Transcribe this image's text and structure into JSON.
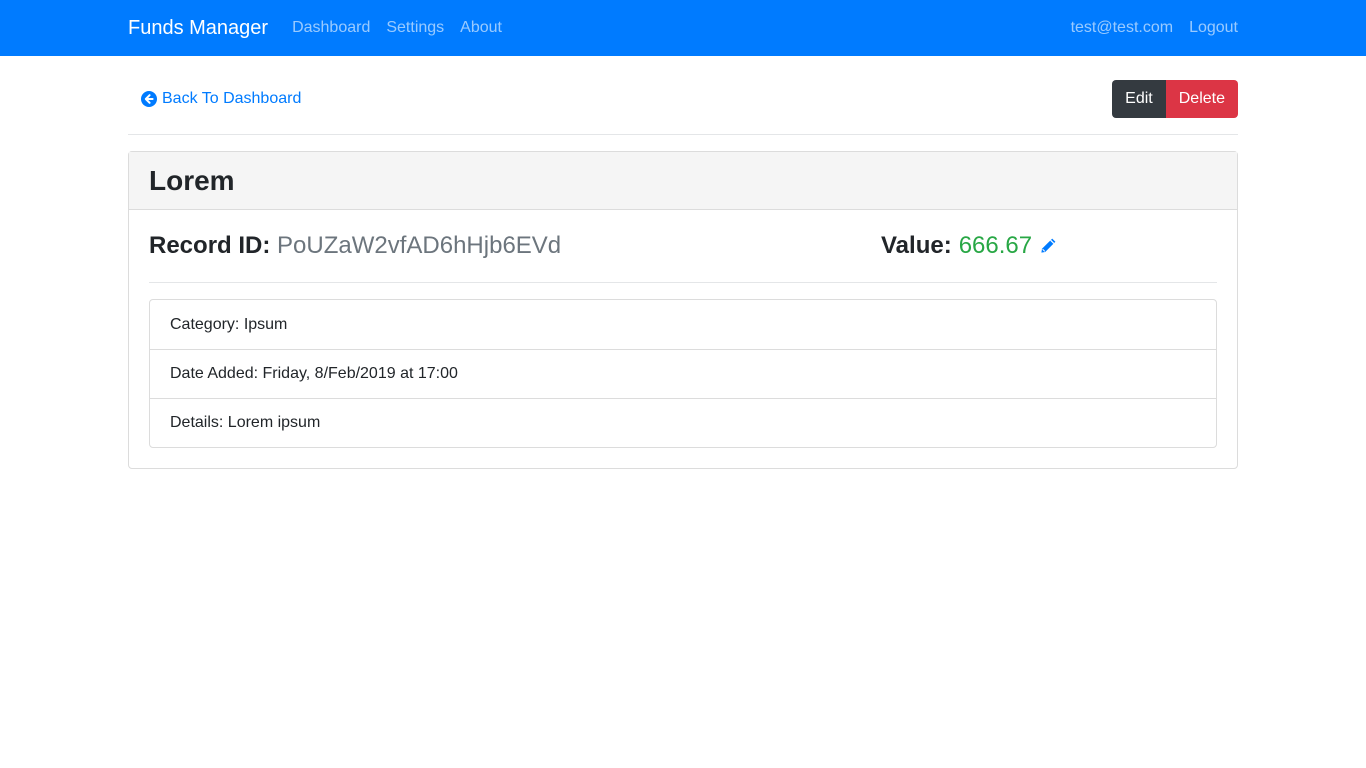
{
  "navbar": {
    "brand": "Funds Manager",
    "links": [
      "Dashboard",
      "Settings",
      "About"
    ],
    "user_email": "test@test.com",
    "logout_label": "Logout"
  },
  "toolbar": {
    "back_label": "Back To Dashboard",
    "edit_label": "Edit",
    "delete_label": "Delete"
  },
  "record": {
    "title": "Lorem",
    "id_label": "Record ID:",
    "id_value": "PoUZaW2vfAD6hHjb6EVd",
    "value_label": "Value:",
    "value": "666.67",
    "details": [
      "Category: Ipsum",
      "Date Added: Friday, 8/Feb/2019 at 17:00",
      "Details: Lorem ipsum"
    ]
  },
  "icons": {
    "back": "arrow-circle-left-icon",
    "edit_value": "pencil-icon"
  },
  "colors": {
    "primary": "#007bff",
    "dark": "#343a40",
    "danger": "#dc3545",
    "success": "#28a745",
    "muted": "#6c757d"
  }
}
